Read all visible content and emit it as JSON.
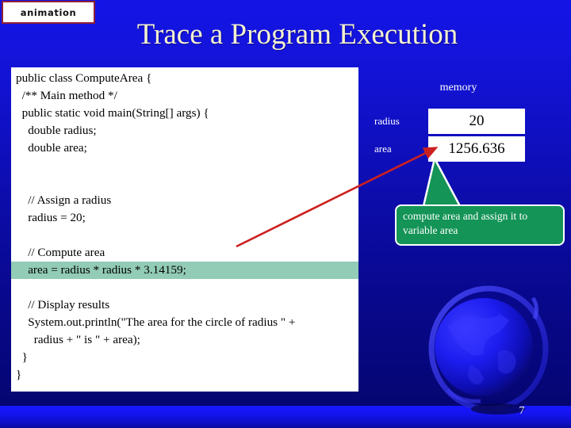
{
  "badge": {
    "label": "animation"
  },
  "header": {
    "title": "Trace a Program Execution"
  },
  "code_panel": {
    "lines": [
      {
        "text": "public class ComputeArea {",
        "highlight": false
      },
      {
        "text": "  /** Main method */",
        "highlight": false
      },
      {
        "text": "  public static void main(String[] args) {",
        "highlight": false
      },
      {
        "text": "    double radius;",
        "highlight": false
      },
      {
        "text": "    double area;",
        "highlight": false
      },
      {
        "text": "",
        "highlight": false
      },
      {
        "text": "",
        "highlight": false
      },
      {
        "text": "    // Assign a radius",
        "highlight": false
      },
      {
        "text": "    radius = 20;",
        "highlight": false
      },
      {
        "text": "",
        "highlight": false
      },
      {
        "text": "    // Compute area",
        "highlight": false
      },
      {
        "text": "    area = radius * radius * 3.14159;",
        "highlight": true
      },
      {
        "text": "",
        "highlight": false
      },
      {
        "text": "    // Display results",
        "highlight": false
      },
      {
        "text": "    System.out.println(\"The area for the circle of radius \" +",
        "highlight": false
      },
      {
        "text": "      radius + \" is \" + area);",
        "highlight": false
      },
      {
        "text": "  }",
        "highlight": false
      },
      {
        "text": "}",
        "highlight": false
      }
    ]
  },
  "memory": {
    "title": "memory",
    "rows": [
      {
        "label": "radius",
        "value": "20"
      },
      {
        "label": "area",
        "value": "1256.636"
      }
    ]
  },
  "callout": {
    "text": "compute area and assign it to variable area"
  },
  "footer": {
    "page_number": "7"
  },
  "colors": {
    "background_top": "#1414e6",
    "background_bottom": "#050570",
    "bottom_band": "#1616ff",
    "title_text": "#f5f2d0",
    "badge_border": "#8e2034",
    "code_highlight": "#92cbb6",
    "callout_fill": "#149457",
    "arrow": "#cc2020"
  },
  "icons": {
    "globe": "globe-icon"
  }
}
